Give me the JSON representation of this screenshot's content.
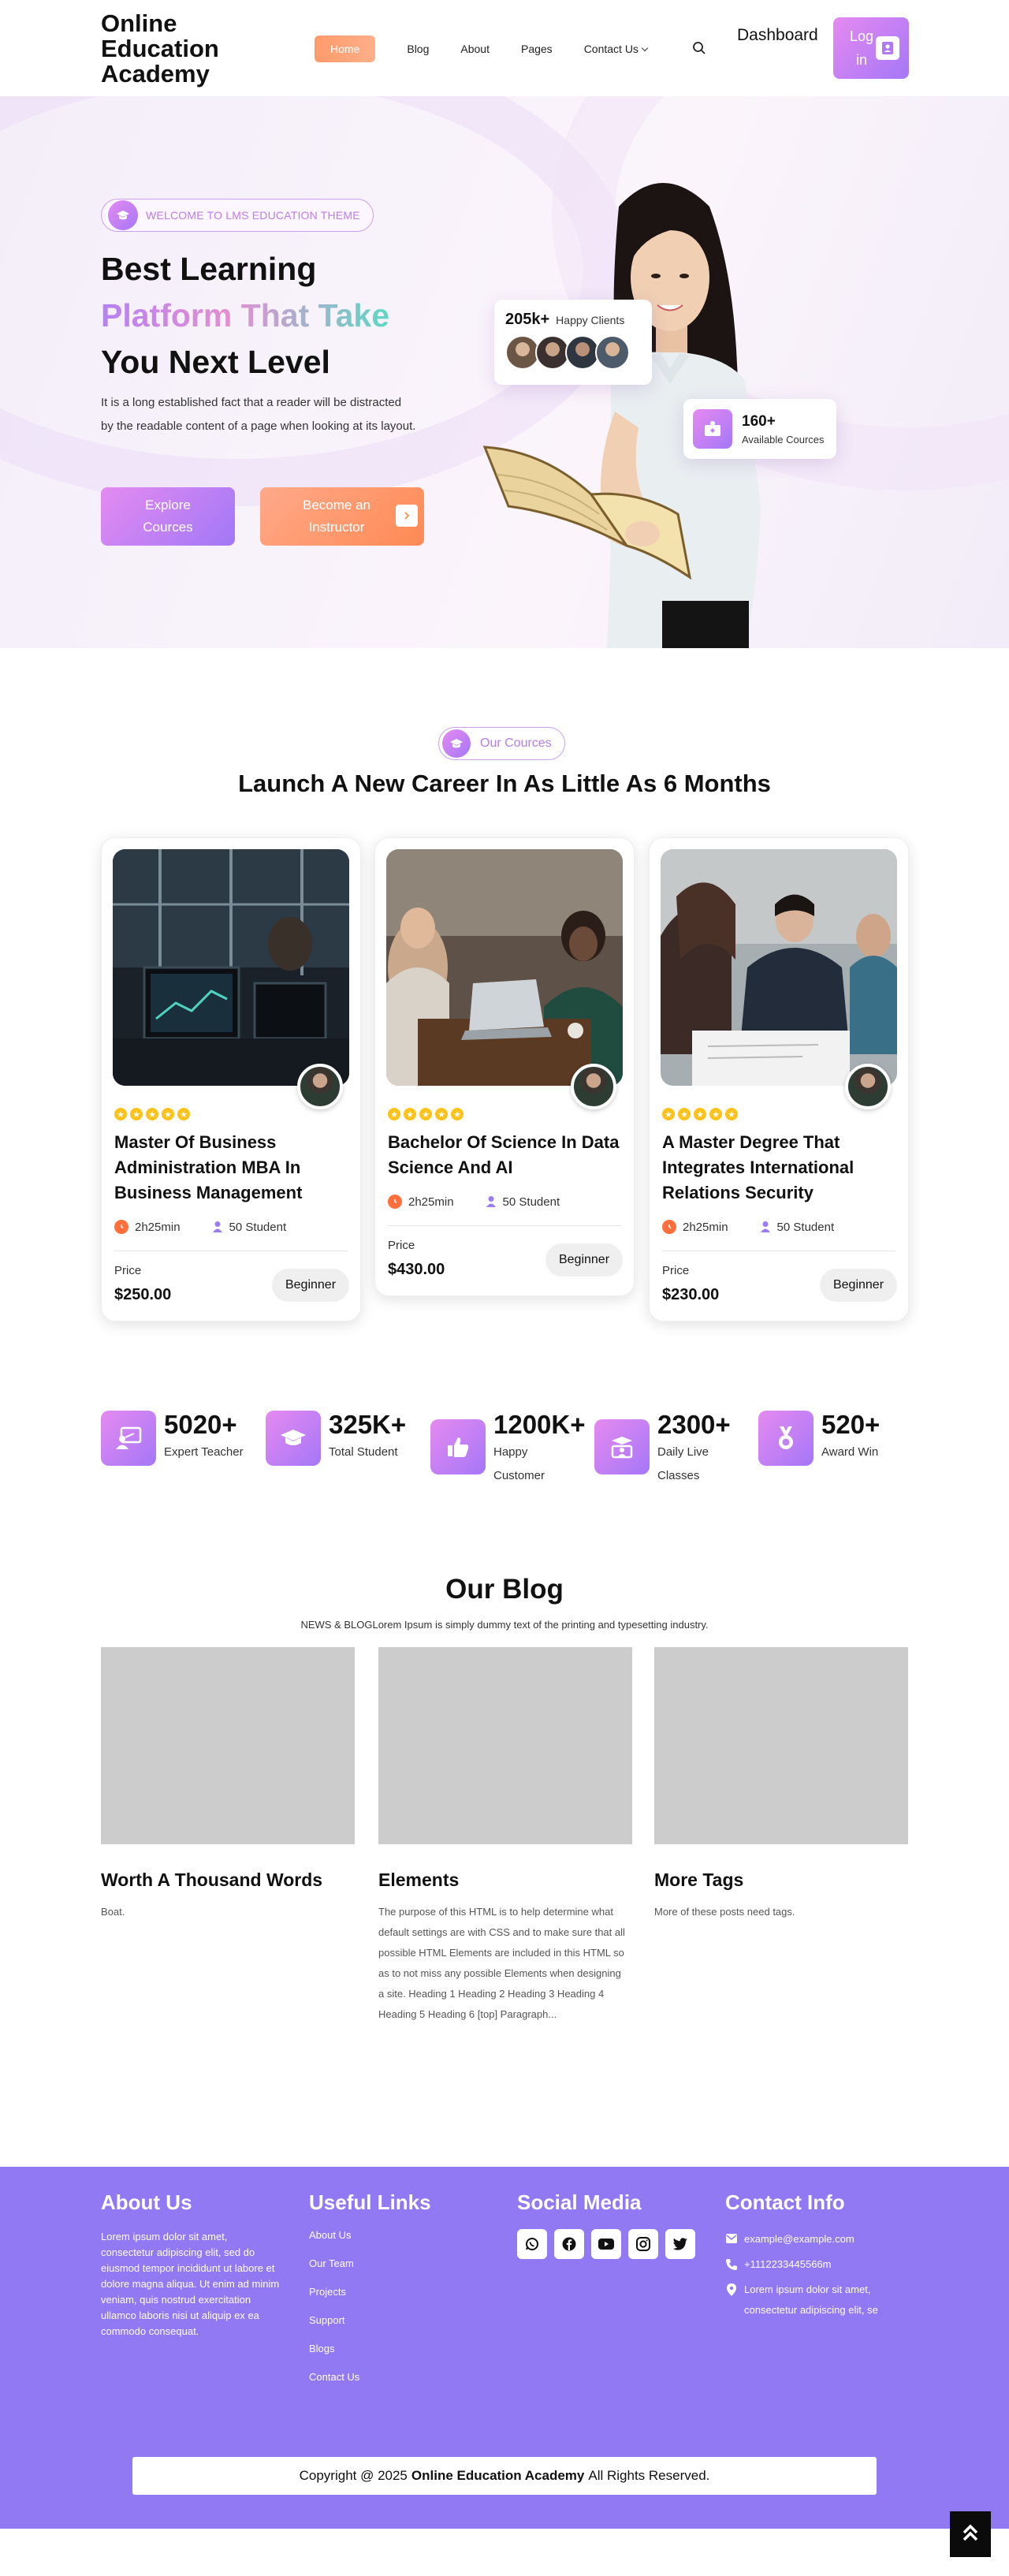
{
  "header": {
    "brand": "Online Education Academy",
    "nav": [
      {
        "label": "Home"
      },
      {
        "label": "Blog"
      },
      {
        "label": "About"
      },
      {
        "label": "Pages"
      },
      {
        "label": "Contact Us"
      }
    ],
    "dashboard_label": "Dashboard",
    "login_label": "Log in"
  },
  "hero": {
    "welcome": "WELCOME TO LMS EDUCATION THEME",
    "heading_line1": "Best Learning",
    "heading_line2": "Platform That Take",
    "heading_line3": "You Next Level",
    "description": "It is a long established fact that a reader will be distracted by the readable content of a page when looking at its layout.",
    "btn_explore": "Explore Cources",
    "btn_instructor": "Become an Instructor",
    "clients_num": "205k+",
    "clients_label": "Happy Clients",
    "courses_num": "160+",
    "courses_label": "Available Cources"
  },
  "courses_section": {
    "pill": "Our Cources",
    "title": "Launch A New Career In As Little As 6 Months",
    "items": [
      {
        "title": "Master Of Business Administration MBA In Business Management",
        "duration": "2h25min",
        "students": "50 Student",
        "price_label": "Price",
        "price": "$250.00",
        "level": "Beginner"
      },
      {
        "title": "Bachelor Of Science In Data Science And AI",
        "duration": "2h25min",
        "students": "50 Student",
        "price_label": "Price",
        "price": "$430.00",
        "level": "Beginner"
      },
      {
        "title": "A Master Degree That Integrates International Relations Security",
        "duration": "2h25min",
        "students": "50 Student",
        "price_label": "Price",
        "price": "$230.00",
        "level": "Beginner"
      }
    ]
  },
  "stats": [
    {
      "num": "5020+",
      "label": "Expert Teacher",
      "icon": "teacher-board-icon"
    },
    {
      "num": "325K+",
      "label": "Total Student",
      "icon": "graduation-cap-icon"
    },
    {
      "num": "1200K+",
      "label": "Happy Customer",
      "icon": "thumbs-up-icon"
    },
    {
      "num": "2300+",
      "label": "Daily Live Classes",
      "icon": "live-class-icon"
    },
    {
      "num": "520+",
      "label": "Award Win",
      "icon": "award-medal-icon"
    }
  ],
  "blog": {
    "title": "Our Blog",
    "subtitle": "NEWS & BLOGLorem Ipsum is simply dummy text of the printing and typesetting industry.",
    "posts": [
      {
        "title": "Worth A Thousand Words",
        "excerpt": "Boat."
      },
      {
        "title": "Elements",
        "excerpt": "The purpose of this HTML is to help determine what default settings are with CSS and to make sure that all possible HTML Elements are included in this HTML so as to not miss any possible Elements when designing a site. Heading 1 Heading 2 Heading 3 Heading 4 Heading 5 Heading 6 [top] Paragraph..."
      },
      {
        "title": "More Tags",
        "excerpt": "More of these posts need tags."
      }
    ]
  },
  "footer": {
    "about_title": "About Us",
    "about_text": "Lorem ipsum dolor sit amet, consectetur adipiscing elit, sed do eiusmod tempor incididunt ut labore et dolore magna aliqua. Ut enim ad minim veniam, quis nostrud exercitation ullamco laboris nisi ut aliquip ex ea commodo consequat.",
    "links_title": "Useful Links",
    "links": [
      "About Us",
      "Our Team",
      "Projects",
      "Support",
      "Blogs",
      "Contact Us"
    ],
    "social_title": "Social Media",
    "social_icons": [
      "whatsapp-icon",
      "facebook-icon",
      "youtube-icon",
      "instagram-icon",
      "twitter-icon"
    ],
    "contact_title": "Contact Info",
    "email": "example@example.com",
    "phone": "+1112233445566m",
    "address": "Lorem ipsum dolor sit amet, consectetur adipiscing elit, se",
    "copyright_prefix": "Copyright @ 2025",
    "copyright_brand": "Online Education Academy",
    "copyright_suffix": "All Rights Reserved."
  },
  "colors": {
    "accent_purple": "#a577f7",
    "accent_pink": "#e58af0",
    "accent_orange": "#ff8a54",
    "footer_bg": "#9079f3",
    "star": "#ffc21a"
  }
}
